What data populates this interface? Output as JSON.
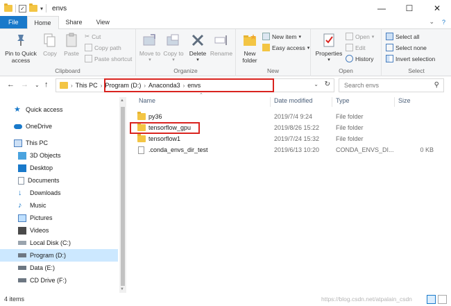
{
  "window": {
    "title": "envs",
    "minimize": "—",
    "maximize": "☐",
    "close": "✕"
  },
  "tabs": [
    {
      "label": "File"
    },
    {
      "label": "Home"
    },
    {
      "label": "Share"
    },
    {
      "label": "View"
    }
  ],
  "ribbon": {
    "clipboard": {
      "label": "Clipboard",
      "pin": "Pin to Quick access",
      "copy": "Copy",
      "paste": "Paste",
      "cut": "Cut",
      "copy_path": "Copy path",
      "paste_shortcut": "Paste shortcut"
    },
    "organize": {
      "label": "Organize",
      "move_to": "Move to",
      "copy_to": "Copy to",
      "delete": "Delete",
      "rename": "Rename"
    },
    "new": {
      "label": "New",
      "new_folder": "New folder",
      "new_item": "New item",
      "easy_access": "Easy access"
    },
    "open": {
      "label": "Open",
      "properties": "Properties",
      "open": "Open",
      "edit": "Edit",
      "history": "History"
    },
    "select": {
      "label": "Select",
      "select_all": "Select all",
      "select_none": "Select none",
      "invert": "Invert selection"
    }
  },
  "address": {
    "crumbs": [
      "This PC",
      "Program (D:)",
      "Anaconda3",
      "envs"
    ],
    "search_placeholder": "Search envs"
  },
  "nav": {
    "items": [
      {
        "label": "Quick access"
      },
      {
        "label": "OneDrive"
      },
      {
        "label": "This PC"
      },
      {
        "label": "3D Objects"
      },
      {
        "label": "Desktop"
      },
      {
        "label": "Documents"
      },
      {
        "label": "Downloads"
      },
      {
        "label": "Music"
      },
      {
        "label": "Pictures"
      },
      {
        "label": "Videos"
      },
      {
        "label": "Local Disk (C:)"
      },
      {
        "label": "Program (D:)"
      },
      {
        "label": "Data (E:)"
      },
      {
        "label": "CD Drive (F:)"
      }
    ]
  },
  "list": {
    "columns": [
      "Name",
      "Date modified",
      "Type",
      "Size"
    ],
    "rows": [
      {
        "name": "py36",
        "date": "2019/7/4 9:24",
        "type": "File folder",
        "size": ""
      },
      {
        "name": "tensorflow_gpu",
        "date": "2019/8/26 15:22",
        "type": "File folder",
        "size": ""
      },
      {
        "name": "tensorflow1",
        "date": "2019/7/24 15:32",
        "type": "File folder",
        "size": ""
      },
      {
        "name": ".conda_envs_dir_test",
        "date": "2019/6/13 10:20",
        "type": "CONDA_ENVS_DI...",
        "size": "0 KB"
      }
    ]
  },
  "status": {
    "count": "4 items",
    "watermark": "https://blog.csdn.net/atpalain_csdn"
  },
  "colors": {
    "accent": "#1979ca",
    "folder": "#f3c544",
    "highlight": "#d9231e",
    "selected": "#cce8ff"
  }
}
